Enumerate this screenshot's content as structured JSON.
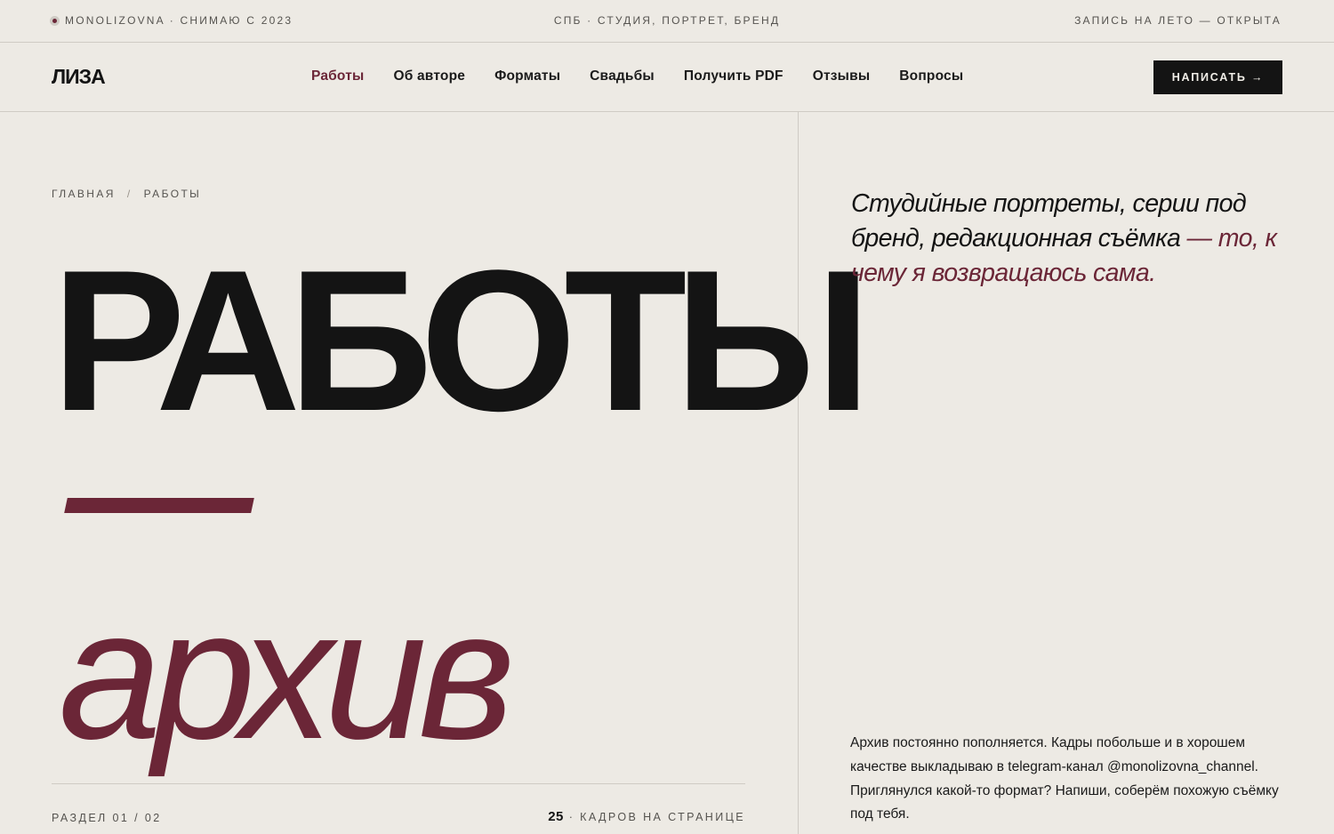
{
  "topbar": {
    "brand": "MONOLIZOVNA · СНИМАЮ С 2023",
    "center": "СПБ · СТУДИЯ, ПОРТРЕТ, БРЕНД",
    "booking": "ЗАПИСЬ НА ЛЕТО — ОТКРЫТА"
  },
  "nav": {
    "logo": "ЛИЗА",
    "items": [
      {
        "label": "Работы",
        "active": true
      },
      {
        "label": "Об авторе"
      },
      {
        "label": "Форматы"
      },
      {
        "label": "Свадьбы"
      },
      {
        "label": "Получить PDF"
      },
      {
        "label": "Отзывы"
      },
      {
        "label": "Вопросы"
      }
    ],
    "cta": "НАПИСАТЬ →"
  },
  "breadcrumb": {
    "home": "ГЛАВНАЯ",
    "separator": "/",
    "current": "РАБОТЫ"
  },
  "hero": {
    "title": "РАБОТЫ",
    "subtitle": "архив"
  },
  "footer_left": {
    "section": "РАЗДЕЛ 01 / 02",
    "count": "25",
    "count_label": " · КАДРОВ НА СТРАНИЦЕ"
  },
  "aside": {
    "lead_main": "Студийные портреты, серии под бренд, редакционная съёмка",
    "lead_accent": " — то, к чему я возвращаюсь сама.",
    "note": "Архив постоянно пополняется. Кадры побольше и в хорошем качестве выкладываю в telegram-канал @monolizovna_channel. Приглянулся какой-то формат? Напиши, соберём похожую съёмку под тебя."
  },
  "colors": {
    "background": "#edeae4",
    "accent": "#6b2637",
    "ink": "#141414"
  }
}
